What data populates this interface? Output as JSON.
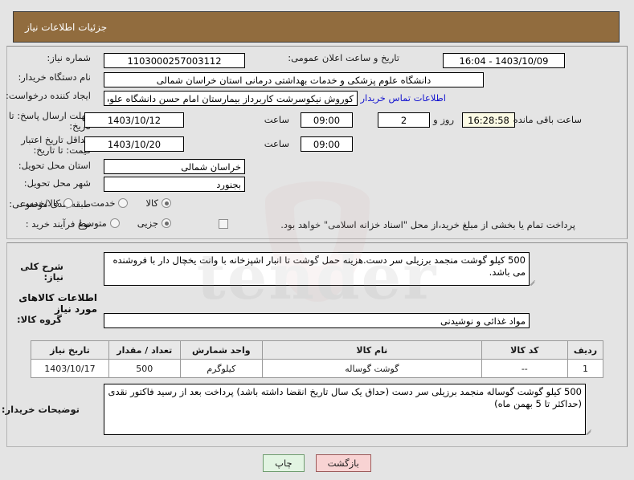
{
  "header": {
    "title": "جزئیات اطلاعات نیاز"
  },
  "form": {
    "need_number_label": "شماره نیاز:",
    "need_number_value": "1103000257003112",
    "announce_label": "تاریخ و ساعت اعلان عمومی:",
    "announce_value": "16:04 - 1403/10/09",
    "buyer_org_label": "نام دستگاه خریدار:",
    "buyer_org_value": "دانشگاه علوم پزشکی و خدمات بهداشتی درمانی استان خراسان شمالی",
    "requester_label": "ایجاد کننده درخواست:",
    "requester_value": "کوروش نیکوسرشت کاربرداز بیمارستان امام حسن دانشگاه علوم پزشکی و خدم",
    "contact_link": "اطلاعات تماس خریدار",
    "deadline_label": "مهلت ارسال پاسخ: تا تاریخ:",
    "deadline_date": "1403/10/12",
    "hour_label": "ساعت",
    "deadline_time": "09:00",
    "days_value": "2",
    "days_label": "روز و",
    "countdown_value": "16:28:58",
    "countdown_label": "ساعت باقی مانده",
    "validity_label": "حداقل تاریخ اعتبار قیمت: تا تاریخ:",
    "validity_date": "1403/10/20",
    "validity_time": "09:00",
    "province_label": "استان محل تحویل:",
    "province_value": "خراسان شمالی",
    "city_label": "شهر محل تحویل:",
    "city_value": "بجنورد",
    "category_label": "طبقه بندی موضوعی:",
    "category_options": [
      "کالا",
      "خدمت",
      "کالا/خدمت"
    ],
    "category_selected": "کالا",
    "process_label": "نوع فرآیند خرید :",
    "process_options": [
      "جزیی",
      "متوسط"
    ],
    "process_selected": "جزیی",
    "treasury_note": "پرداخت تمام یا بخشی از مبلغ خرید،از محل \"اسناد خزانه اسلامی\" خواهد بود.",
    "treasury_checked": false
  },
  "description": {
    "summary_label": "شرح کلی نیاز:",
    "summary_value": "500 کیلو گوشت منجمد برزیلی سر دست.هزینه حمل گوشت تا انبار اشپزخانه با وانت یخچال دار با فروشنده می باشد.",
    "section_title": "اطلاعات کالاهای مورد نیاز",
    "group_label": "گروه کالا:",
    "group_value": "مواد غذائی و نوشیدنی"
  },
  "table": {
    "headers": [
      "ردیف",
      "کد کالا",
      "نام کالا",
      "واحد شمارش",
      "تعداد / مقدار",
      "تاریخ نیاز"
    ],
    "rows": [
      {
        "index": "1",
        "code": "--",
        "name": "گوشت گوساله",
        "unit": "کیلوگرم",
        "qty": "500",
        "date": "1403/10/17"
      }
    ]
  },
  "notes": {
    "label": "توضیحات خریدار:",
    "value": "500 کیلو گوشت گوساله منجمد برزیلی سر دست (حداق یک سال تاریخ انقضا داشته باشد) پرداخت بعد از رسید فاکتور نقدی (حداکثر تا 5 بهمن ماه)"
  },
  "buttons": {
    "back": "بازگشت",
    "print": "چاپ"
  },
  "watermark": {
    "text": "tender"
  },
  "colors": {
    "header_bg": "#916c3e",
    "page_bg": "#e4e4e4",
    "link": "#1515cf",
    "back_btn": "#f8d3d3",
    "print_btn": "#e2f4e2",
    "countdown_bg": "#fbfae4"
  }
}
